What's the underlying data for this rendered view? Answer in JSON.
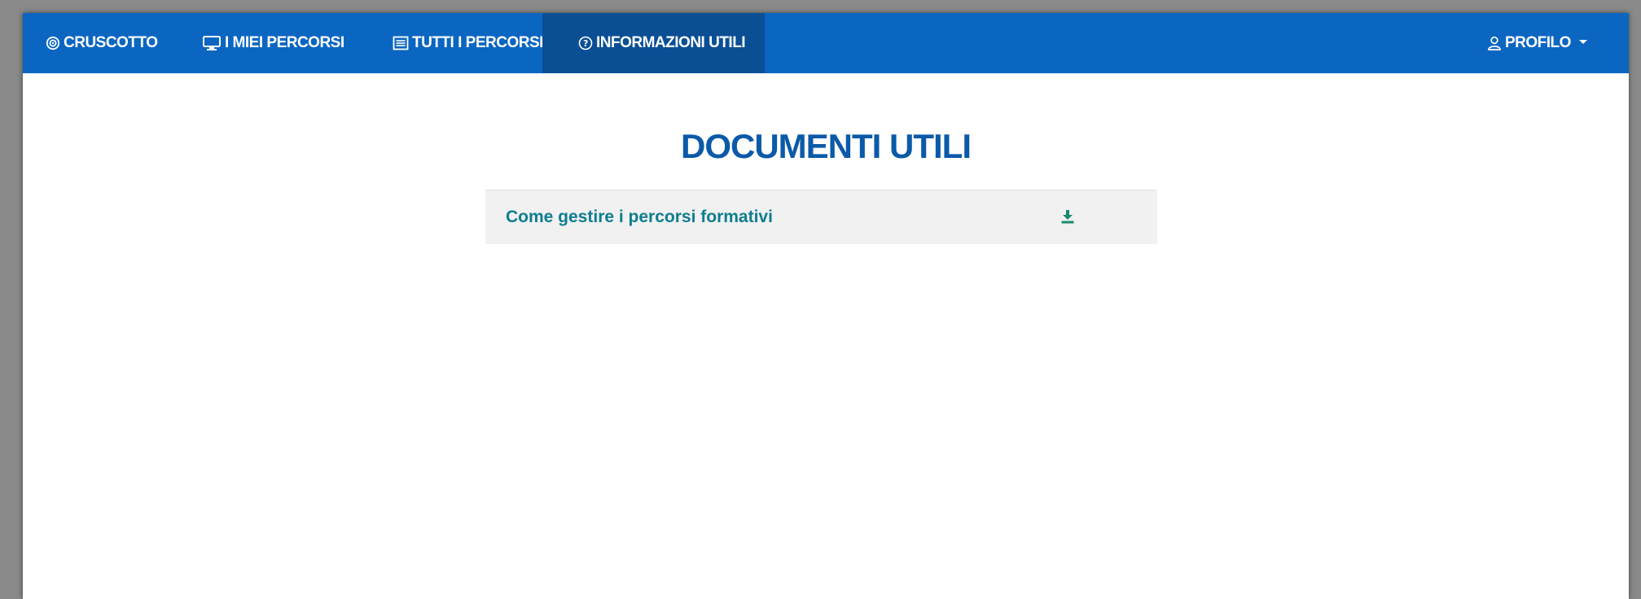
{
  "nav": {
    "items": [
      {
        "label": "CRUSCOTTO",
        "icon": "dashboard-icon"
      },
      {
        "label": "I MIEI PERCORSI",
        "icon": "monitor-icon"
      },
      {
        "label": "TUTTI I PERCORSI",
        "icon": "list-icon"
      },
      {
        "label": "INFORMAZIONI UTILI",
        "icon": "help-icon",
        "active": true
      }
    ],
    "profile": {
      "label": "PROFILO",
      "icon": "user-icon"
    }
  },
  "main": {
    "title": "DOCUMENTI UTILI",
    "documents": [
      {
        "title": "Come gestire i percorsi formativi",
        "action_icon": "download-icon"
      }
    ]
  },
  "colors": {
    "navbar": "#0b66c2",
    "navbar_active": "#0a4f94",
    "title": "#0b5aa8",
    "link": "#0d7d8f",
    "download_icon": "#1a8a6e"
  }
}
